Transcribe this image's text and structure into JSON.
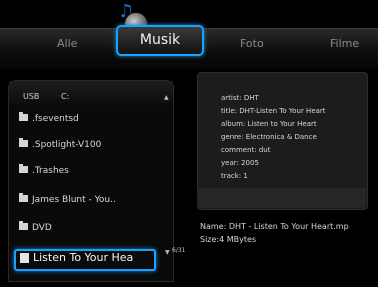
{
  "tabs": {
    "alle": "Alle",
    "musik": "Musik",
    "foto": "Foto",
    "filme": "Filme"
  },
  "browser": {
    "device": "USB",
    "drive": "C:",
    "page": "6/31",
    "items": [
      {
        "label": ".fseventsd",
        "icon": "folder-icon"
      },
      {
        "label": ".Spotlight-V100",
        "icon": "folder-icon"
      },
      {
        "label": ".Trashes",
        "icon": "folder-icon"
      },
      {
        "label": "James Blunt - You..",
        "icon": "folder-icon"
      },
      {
        "label": "DVD",
        "icon": "folder-icon"
      },
      {
        "label": "Listen To Your Hea",
        "icon": "music-file-icon",
        "selected": true
      }
    ]
  },
  "info": {
    "artist": "artist: DHT",
    "title": "title: DHT-Listen To Your Heart",
    "album": "album: Listen to Your Heart",
    "genre": "genre: Electronica & Dance",
    "comment": "comment: dut",
    "year": "year: 2005",
    "track": "track: 1"
  },
  "file": {
    "name": "Name: DHT - Listen To Your Heart.mp",
    "size": "Size:4 MBytes"
  },
  "colors": {
    "accent": "#1aa0ff",
    "background": "#000000"
  }
}
